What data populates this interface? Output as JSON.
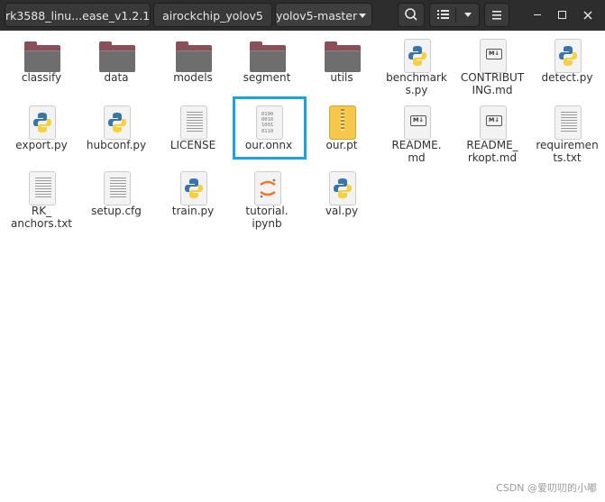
{
  "header": {
    "breadcrumbs": [
      {
        "label": "rk3588_linu...ease_v1.2.1"
      },
      {
        "label": "airockchip_yolov5"
      },
      {
        "label": "yolov5-master"
      }
    ]
  },
  "files": [
    {
      "name": "classify",
      "type": "folder"
    },
    {
      "name": "data",
      "type": "folder"
    },
    {
      "name": "models",
      "type": "folder"
    },
    {
      "name": "segment",
      "type": "folder"
    },
    {
      "name": "utils",
      "type": "folder"
    },
    {
      "name": "benchmarks.py",
      "label_lines": [
        "benchmark",
        "s.py"
      ],
      "type": "python"
    },
    {
      "name": "CONTRIBUTING.md",
      "label_lines": [
        "CONTRIBUT",
        "ING.md"
      ],
      "type": "markdown"
    },
    {
      "name": "detect.py",
      "type": "python"
    },
    {
      "name": "export.py",
      "type": "python"
    },
    {
      "name": "hubconf.py",
      "type": "python"
    },
    {
      "name": "LICENSE",
      "type": "text"
    },
    {
      "name": "our.onnx",
      "type": "binary",
      "selected": true
    },
    {
      "name": "our.pt",
      "type": "archive"
    },
    {
      "name": "README.md",
      "label_lines": [
        "README.",
        "md"
      ],
      "type": "markdown"
    },
    {
      "name": "README_rkopt.md",
      "label_lines": [
        "README_",
        "rkopt.md"
      ],
      "type": "markdown"
    },
    {
      "name": "requirements.txt",
      "label_lines": [
        "requiremen",
        "ts.txt"
      ],
      "type": "text"
    },
    {
      "name": "RK_anchors.txt",
      "label_lines": [
        "RK_",
        "anchors.txt"
      ],
      "type": "text"
    },
    {
      "name": "setup.cfg",
      "type": "text"
    },
    {
      "name": "train.py",
      "type": "python"
    },
    {
      "name": "tutorial.ipynb",
      "label_lines": [
        "tutorial.",
        "ipynb"
      ],
      "type": "jupyter"
    },
    {
      "name": "val.py",
      "type": "python"
    }
  ],
  "binary_glyph": [
    "0100",
    "0010",
    "1001",
    "0110"
  ],
  "markdown_glyph": "M↓",
  "watermark": "CSDN @爱叨叨的小嘟",
  "colors": {
    "header_bg": "#2d2d2d",
    "selection_border": "#1aa3e2",
    "folder_back": "#8a4f57",
    "folder_front": "#6e6e6e",
    "python_blue": "#3a74a8",
    "python_yellow": "#f5d041",
    "archive_yellow": "#f5c84c",
    "jupyter_orange": "#f37626"
  }
}
